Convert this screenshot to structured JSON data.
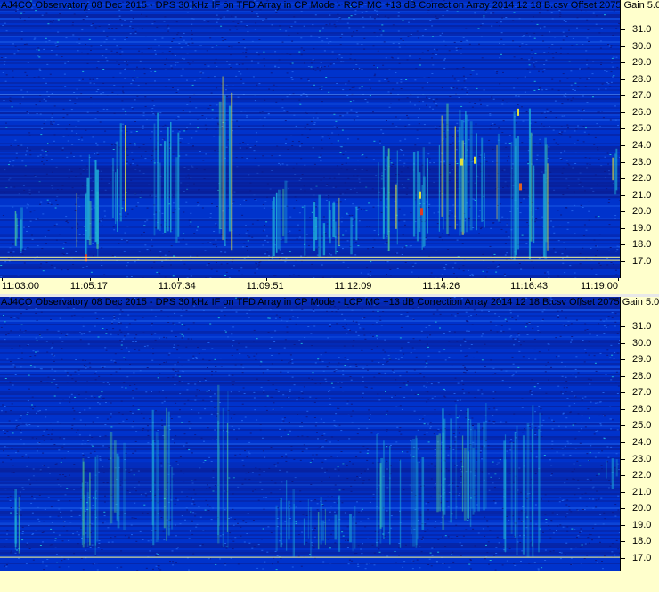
{
  "chart_data": [
    {
      "type": "heatmap",
      "title": "AJ4CO Observatory 08 Dec 2015 - DPS 30 kHz IF on TFD Array in CP Mode - RCP  MC +13 dB  Correction Array 2014 12 18 B.csv  Offset 2075  Gain 5.0",
      "x_ticks": [
        "11:03:00",
        "11:05:17",
        "11:07:34",
        "11:09:51",
        "11:12:09",
        "11:14:26",
        "11:16:43",
        "11:19:00"
      ],
      "y_ticks": [
        "31.0",
        "30.0",
        "29.0",
        "28.0",
        "27.0",
        "26.0",
        "25.0",
        "24.0",
        "23.0",
        "22.0",
        "21.0",
        "20.0",
        "19.0",
        "18.0",
        "17.0"
      ],
      "xlim": [
        "11:03:00",
        "11:19:00"
      ],
      "ylim": [
        16.5,
        31.6
      ],
      "intensity_lines_mhz": [
        17.25,
        17.05,
        27.1
      ],
      "colormap": [
        "#0a1a8c",
        "#0033cc",
        "#1e5fe8",
        "#1fb0d8",
        "#5ee08a",
        "#e0e040",
        "#e03a20"
      ]
    },
    {
      "type": "heatmap",
      "title": "AJ4CO Observatory 08 Dec 2015 - DPS 30 kHz IF on TFD Array in CP Mode - LCP  MC +13 dB  Correction Array 2014 12 18 B.csv  Offset 2075  Gain 5.0",
      "x_ticks": [],
      "y_ticks": [
        "31.0",
        "30.0",
        "29.0",
        "28.0",
        "27.0",
        "26.0",
        "25.0",
        "24.0",
        "23.0",
        "22.0",
        "21.0",
        "20.0",
        "19.0",
        "18.0",
        "17.0"
      ],
      "xlim": [
        "11:03:00",
        "11:19:00"
      ],
      "ylim": [
        16.5,
        31.6
      ],
      "intensity_lines_mhz": [
        17.05,
        27.1
      ],
      "colormap": [
        "#0a1a8c",
        "#0033cc",
        "#1e5fe8",
        "#1fb0d8",
        "#5ee08a",
        "#e0e040"
      ]
    }
  ]
}
